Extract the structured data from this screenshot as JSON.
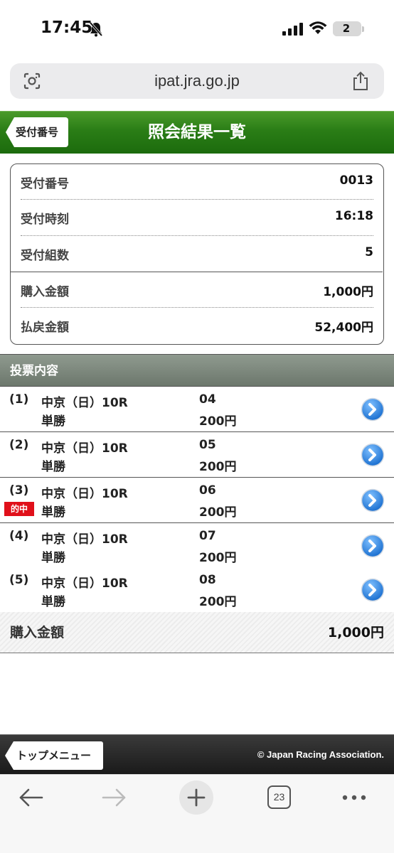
{
  "status_bar": {
    "time": "17:45",
    "battery_level": "2",
    "icons": [
      "bell-slash-icon",
      "signal-icon",
      "wifi-icon",
      "battery-icon"
    ]
  },
  "browser": {
    "url": "ipat.jra.go.jp",
    "tab_count": "23",
    "icons": [
      "camera-search-icon",
      "share-icon",
      "back-arrow-icon",
      "forward-arrow-icon",
      "plus-icon",
      "tabs-icon",
      "more-icon"
    ]
  },
  "header": {
    "back_label": "受付番号",
    "title": "照会結果一覧",
    "color": "#2a7d16"
  },
  "summary": {
    "rows": [
      {
        "label": "受付番号",
        "value": "0013"
      },
      {
        "label": "受付時刻",
        "value": "16:18"
      },
      {
        "label": "受付組数",
        "value": "5"
      },
      {
        "label": "購入金額",
        "value": "1,000円"
      },
      {
        "label": "払戻金額",
        "value": "52,400円"
      }
    ]
  },
  "bets": {
    "section_title": "投票内容",
    "hit_label": "的中",
    "items": [
      {
        "num": "(1)",
        "race": "中京（日）10R",
        "type": "単勝",
        "horse": "04",
        "amount": "200円",
        "hit": false
      },
      {
        "num": "(2)",
        "race": "中京（日）10R",
        "type": "単勝",
        "horse": "05",
        "amount": "200円",
        "hit": false
      },
      {
        "num": "(3)",
        "race": "中京（日）10R",
        "type": "単勝",
        "horse": "06",
        "amount": "200円",
        "hit": true
      },
      {
        "num": "(4)",
        "race": "中京（日）10R",
        "type": "単勝",
        "horse": "07",
        "amount": "200円",
        "hit": false
      },
      {
        "num": "(5)",
        "race": "中京（日）10R",
        "type": "単勝",
        "horse": "08",
        "amount": "200円",
        "hit": false
      }
    ]
  },
  "total": {
    "label": "購入金額",
    "value": "1,000円"
  },
  "footer": {
    "top_menu_label": "トップメニュー",
    "copyright": "© Japan Racing Association."
  }
}
